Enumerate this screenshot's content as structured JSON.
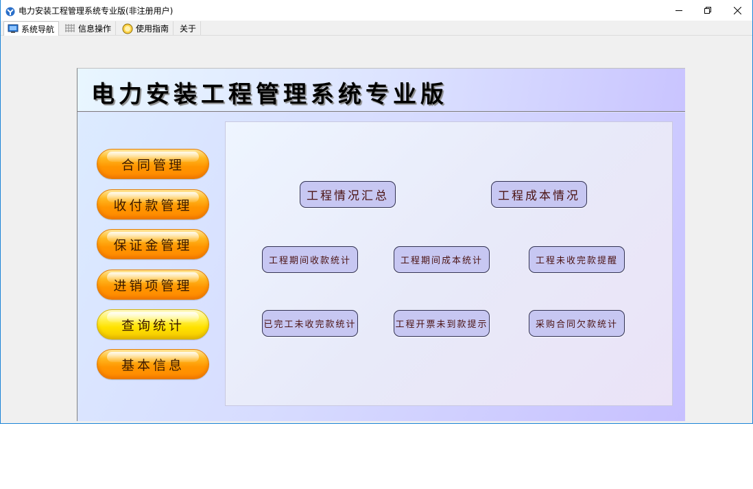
{
  "window": {
    "title": "电力安装工程管理系统专业版(非注册用户)",
    "accent_color": "#1883d7",
    "icons": {
      "app": "app-logo-icon",
      "minimize": "minimize-icon",
      "restore": "restore-icon",
      "close": "close-icon"
    }
  },
  "menu": {
    "tabs": [
      {
        "label": "系统导航",
        "icon": "monitor-icon",
        "active": true
      },
      {
        "label": "信息操作",
        "icon": "grid-icon",
        "active": false
      },
      {
        "label": "使用指南",
        "icon": "help-coin-icon",
        "active": false
      },
      {
        "label": "关于",
        "icon": "",
        "active": false
      }
    ]
  },
  "panel": {
    "title": "电力安装工程管理系统专业版",
    "sidebar": [
      {
        "label": "合同管理",
        "selected": false
      },
      {
        "label": "收付款管理",
        "selected": false
      },
      {
        "label": "保证金管理",
        "selected": false
      },
      {
        "label": "进销项管理",
        "selected": false
      },
      {
        "label": "查询统计",
        "selected": true
      },
      {
        "label": "基本信息",
        "selected": false
      }
    ],
    "functions": {
      "row1": [
        "工程情况汇总",
        "工程成本情况"
      ],
      "row2": [
        "工程期间收款统计",
        "工程期间成本统计",
        "工程未收完款提醒"
      ],
      "row3": [
        "已完工未收完款统计",
        "工程开票未到款提示",
        "采购合同欠款统计"
      ]
    },
    "colors": {
      "sidebar_button": "#ff9500",
      "sidebar_selected": "#ffe200",
      "function_button": "#c7c7f2"
    }
  }
}
